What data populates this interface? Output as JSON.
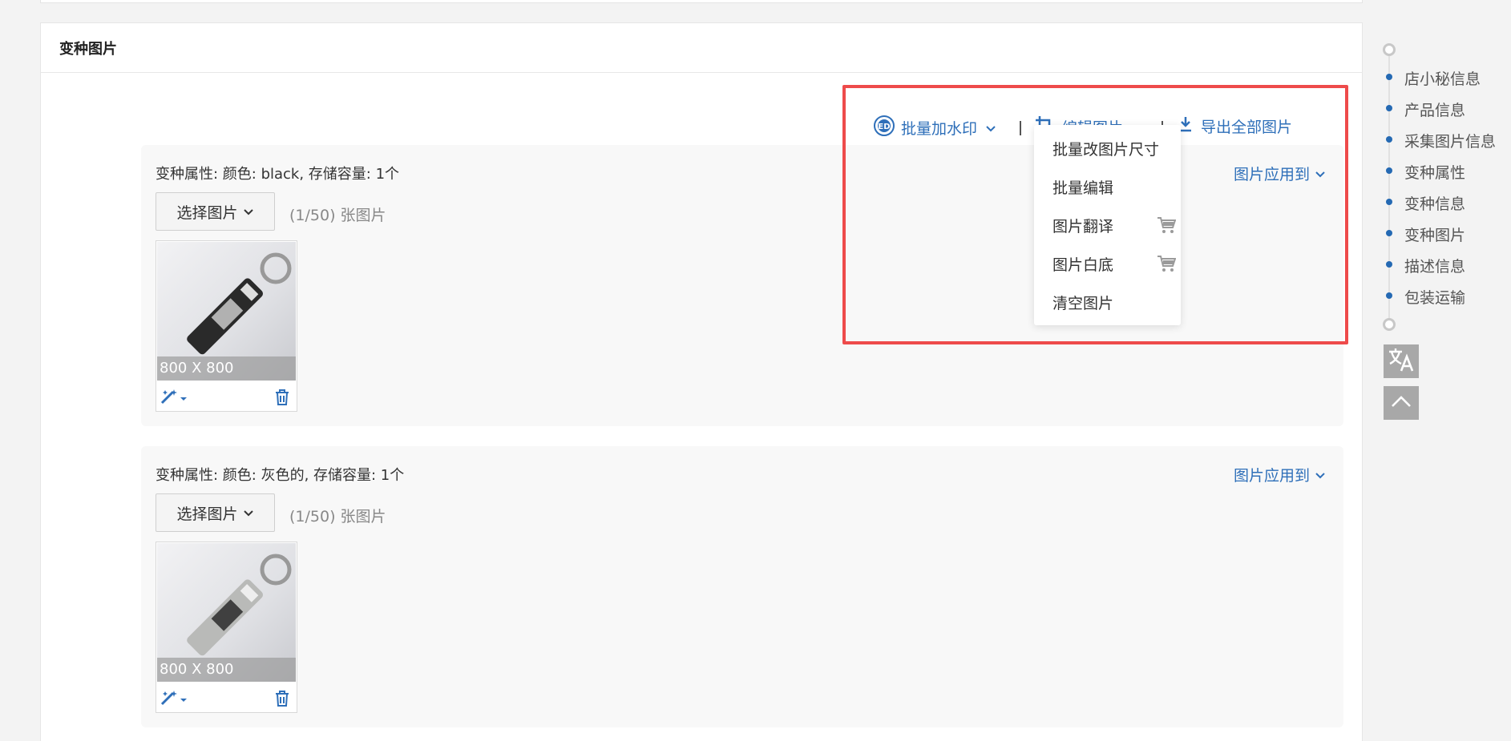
{
  "section": {
    "title": "变种图片"
  },
  "toolbar": {
    "watermark_label": "批量加水印",
    "edit_label": "编辑图片",
    "export_label": "导出全部图片"
  },
  "edit_menu": {
    "items": [
      {
        "label": "批量改图片尺寸",
        "has_cart_icon": false
      },
      {
        "label": "批量编辑",
        "has_cart_icon": false
      },
      {
        "label": "图片翻译",
        "has_cart_icon": true
      },
      {
        "label": "图片白底",
        "has_cart_icon": true
      },
      {
        "label": "清空图片",
        "has_cart_icon": false
      }
    ]
  },
  "variants": [
    {
      "title": "变种属性: 颜色: black, 存储容量: 1个",
      "apply_label": "图片应用到",
      "select_label": "选择图片",
      "count_text": "(1/50) 张图片",
      "image_size": "800 X 800",
      "product_color": "#2a2a2a"
    },
    {
      "title": "变种属性: 颜色: 灰色的, 存储容量: 1个",
      "apply_label": "图片应用到",
      "select_label": "选择图片",
      "count_text": "(1/50) 张图片",
      "image_size": "800 X 800",
      "product_color": "#b9bab8"
    }
  ],
  "side_nav": {
    "items": [
      "店小秘信息",
      "产品信息",
      "采集图片信息",
      "变种属性",
      "变种信息",
      "变种图片",
      "描述信息",
      "包装运输"
    ]
  },
  "colors": {
    "link_blue": "#2e6fb9",
    "highlight_red": "#ee4b4b",
    "nav_dot": "#2469b3"
  }
}
